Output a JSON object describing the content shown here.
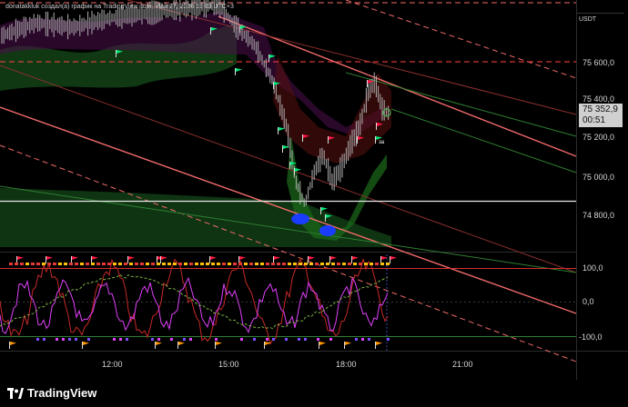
{
  "header": {
    "caption": "donatakkluk создал(а) график на TradingView.com, Май 27, 2026 19:03 UTC+3"
  },
  "price_axis": {
    "currency": "USDT",
    "labels": [
      "75 600,0",
      "75 400,0",
      "75 200,0",
      "75 000,0",
      "74 800,0"
    ],
    "current_price": "75 352,9",
    "countdown": "00:51"
  },
  "oscillator_axis": {
    "labels": [
      "100,0",
      "0,0",
      "-100,0"
    ]
  },
  "time_axis": {
    "labels": [
      "12:00",
      "15:00",
      "18:00",
      "21:00"
    ]
  },
  "flag_label": "за",
  "footer": {
    "brand": "TradingView"
  },
  "colors": {
    "background": "#000000",
    "bull": "#26a69a",
    "bear": "#ef5350",
    "band_green": "#1b5e20",
    "magenta": "#e040fb"
  }
}
